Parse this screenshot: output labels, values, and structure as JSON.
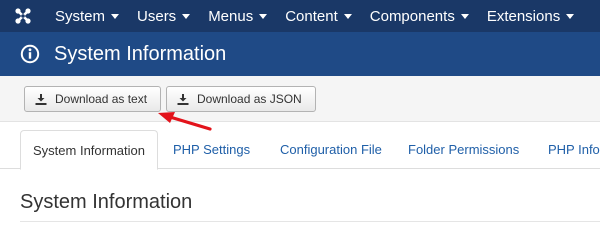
{
  "topnav": {
    "brand_icon": "joomla-logo-icon",
    "items": [
      {
        "label": "System"
      },
      {
        "label": "Users"
      },
      {
        "label": "Menus"
      },
      {
        "label": "Content"
      },
      {
        "label": "Components"
      },
      {
        "label": "Extensions"
      }
    ]
  },
  "titlebar": {
    "icon": "info-icon",
    "title": "System Information"
  },
  "toolbar": {
    "download_text_label": "Download as text",
    "download_json_label": "Download as JSON",
    "button_icon": "download-icon"
  },
  "tabs": [
    {
      "label": "System Information",
      "active": true
    },
    {
      "label": "PHP Settings",
      "active": false
    },
    {
      "label": "Configuration File",
      "active": false
    },
    {
      "label": "Folder Permissions",
      "active": false
    },
    {
      "label": "PHP Info",
      "active": false
    }
  ],
  "section": {
    "title": "System Information"
  },
  "colors": {
    "nav_bg": "#1a3867",
    "title_bg": "#1f4a86",
    "link": "#1f5fa8",
    "annotation_arrow": "#e3131b"
  }
}
